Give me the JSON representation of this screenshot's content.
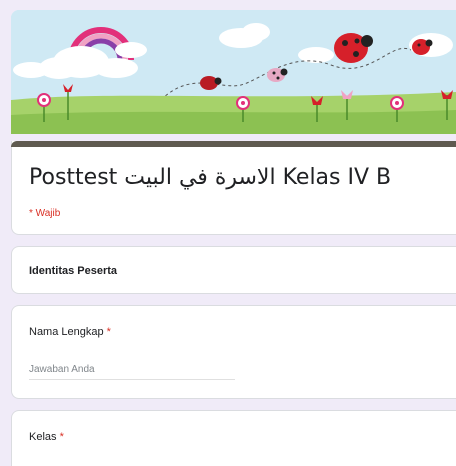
{
  "form": {
    "title": "Posttest الاسرة في البيت Kelas IV B",
    "required_note": "* Wajib"
  },
  "section": {
    "title": "Identitas Peserta"
  },
  "questions": [
    {
      "label": "Nama Lengkap",
      "required_mark": "*",
      "placeholder": "Jawaban Anda"
    },
    {
      "label": "Kelas",
      "required_mark": "*"
    }
  ],
  "colors": {
    "page_bg": "#f0ebf8",
    "title_bar": "#5f5a50",
    "required": "#d93025"
  }
}
